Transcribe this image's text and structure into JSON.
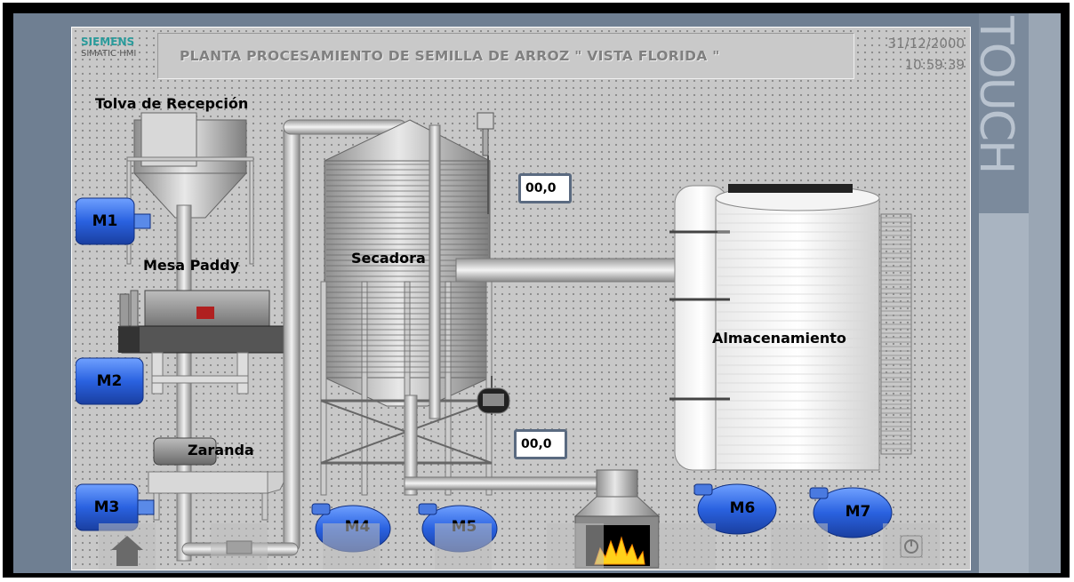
{
  "brand": {
    "name": "SIEMENS",
    "subtitle": "SIMATIC HMI"
  },
  "header": {
    "title": "PLANTA PROCESAMIENTO DE SEMILLA DE ARROZ \" VISTA FLORIDA \"",
    "date": "31/12/2000",
    "time": "10:59:39"
  },
  "panel_text": "TOUCH",
  "equipment": {
    "tolva": "Tolva de Recepción",
    "mesa": "Mesa Paddy",
    "zaranda": "Zaranda",
    "secadora": "Secadora",
    "almacenamiento": "Almacenamiento"
  },
  "motors": [
    "M1",
    "M2",
    "M3",
    "M4",
    "M5",
    "M6",
    "M7"
  ],
  "io_fields": {
    "temperature": "00,0",
    "pressure": "00,0"
  },
  "nav": {
    "home_icon": "home-icon",
    "info_icon": "power-icon"
  }
}
